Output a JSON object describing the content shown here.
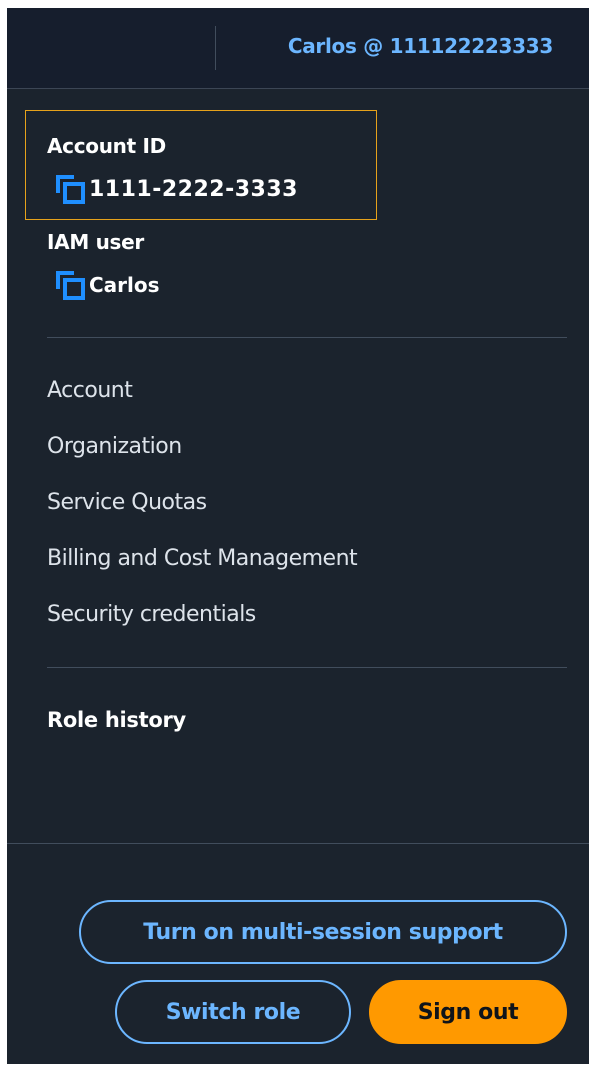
{
  "header": {
    "user_menu_label": "Carlos @ 111122223333"
  },
  "account": {
    "label": "Account ID",
    "value": "1111-2222-3333"
  },
  "iam_user": {
    "label": "IAM user",
    "value": "Carlos"
  },
  "menu": {
    "items": [
      {
        "label": "Account"
      },
      {
        "label": "Organization"
      },
      {
        "label": "Service Quotas"
      },
      {
        "label": "Billing and Cost Management"
      },
      {
        "label": "Security credentials"
      }
    ]
  },
  "role_history": {
    "label": "Role history"
  },
  "actions": {
    "multi_session": "Turn on multi-session support",
    "switch_role": "Switch role",
    "sign_out": "Sign out"
  },
  "colors": {
    "panel_bg": "#1b232d",
    "accent_link": "#6cb6ff",
    "copy_icon": "#1f8fff",
    "focus_outline": "#e6a21b",
    "primary_button": "#ff9900"
  },
  "icons": [
    "copy-icon"
  ]
}
